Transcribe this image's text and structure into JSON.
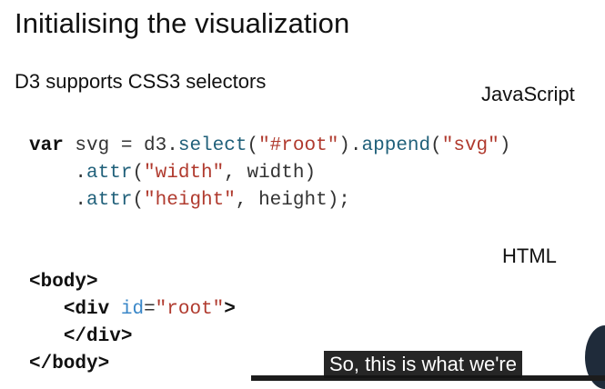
{
  "slide": {
    "title": "Initialising the visualization",
    "subtitle": "D3 supports CSS3 selectors",
    "js_label": "JavaScript",
    "html_label": "HTML"
  },
  "js_code": {
    "line1": {
      "kw": "var",
      "plain1": " svg = d3.",
      "fn1": "select",
      "plain2": "(",
      "str1": "\"#root\"",
      "plain3": ").",
      "fn2": "append",
      "plain4": "(",
      "str2": "\"svg\"",
      "plain5": ")"
    },
    "line2": {
      "indent": "    .",
      "fn": "attr",
      "plain1": "(",
      "str": "\"width\"",
      "plain2": ", width)"
    },
    "line3": {
      "indent": "    .",
      "fn": "attr",
      "plain1": "(",
      "str": "\"height\"",
      "plain2": ", height);"
    }
  },
  "html_code": {
    "line1": "<body>",
    "line2": {
      "indent": "   ",
      "tag_open": "<div",
      "space": " ",
      "attr": "id",
      "eq": "=",
      "str": "\"root\"",
      "close": ">"
    },
    "line3": {
      "indent": "   ",
      "tag": "</div>"
    },
    "line4": "</body>"
  },
  "caption": {
    "text": "So, this is what we're"
  },
  "colors": {
    "string": "#b03a2e",
    "function": "#20607a",
    "attribute": "#3a87c8",
    "caption_bg": "#141414"
  }
}
